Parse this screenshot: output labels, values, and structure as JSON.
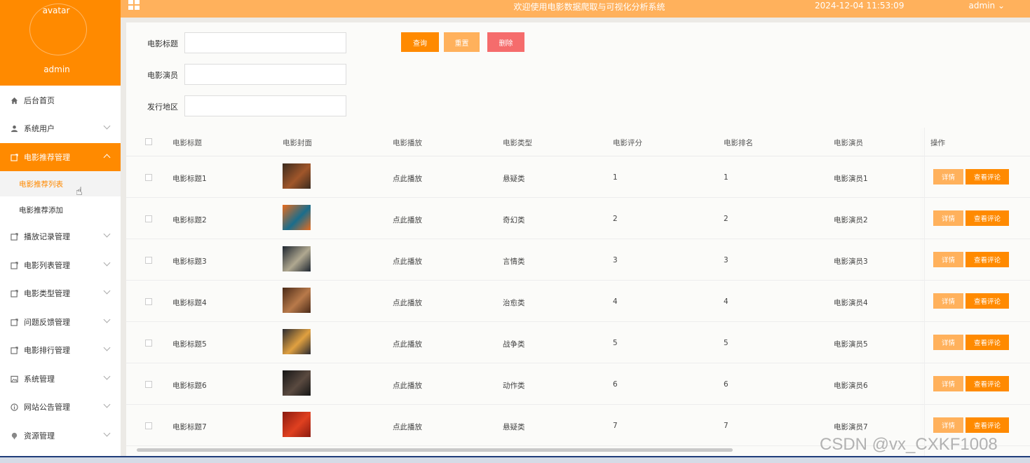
{
  "sidebar": {
    "avatar_text": "avatar",
    "username": "admin",
    "items": [
      {
        "label": "后台首页",
        "icon": "home-icon",
        "expandable": false
      },
      {
        "label": "系统用户",
        "icon": "user-icon",
        "expandable": true
      },
      {
        "label": "电影推荐管理",
        "icon": "folder-icon",
        "expandable": true,
        "active": true
      },
      {
        "label": "播放记录管理",
        "icon": "folder-icon",
        "expandable": true
      },
      {
        "label": "电影列表管理",
        "icon": "folder-icon",
        "expandable": true
      },
      {
        "label": "电影类型管理",
        "icon": "folder-icon",
        "expandable": true
      },
      {
        "label": "问题反馈管理",
        "icon": "folder-icon",
        "expandable": true
      },
      {
        "label": "电影排行管理",
        "icon": "folder-icon",
        "expandable": true
      },
      {
        "label": "系统管理",
        "icon": "image-icon",
        "expandable": true
      },
      {
        "label": "网站公告管理",
        "icon": "info-icon",
        "expandable": true
      },
      {
        "label": "资源管理",
        "icon": "pin-icon",
        "expandable": true
      }
    ],
    "subitems": [
      {
        "label": "电影推荐列表",
        "current": true
      },
      {
        "label": "电影推荐添加",
        "current": false
      }
    ]
  },
  "header": {
    "title": "欢迎使用电影数据爬取与可视化分析系统",
    "time": "2024-12-04 11:53:09",
    "user": "admin ⌄"
  },
  "search": {
    "title_label": "电影标题",
    "actor_label": "电影演员",
    "region_label": "发行地区",
    "title_value": "",
    "actor_value": "",
    "region_value": "",
    "search_button": "查询",
    "reset_button": "重置",
    "delete_button": "删除"
  },
  "table": {
    "headers": [
      "电影标题",
      "电影封面",
      "电影播放",
      "电影类型",
      "电影评分",
      "电影排名",
      "电影演员",
      "操作"
    ],
    "detail_label": "详情",
    "review_label": "查看评论",
    "rows": [
      {
        "title": "电影标题1",
        "play": "点此播放",
        "type": "悬疑类",
        "score": "1",
        "rank": "1",
        "actor": "电影演员1",
        "cover_colors": [
          "#3a2a1e",
          "#a0562a"
        ]
      },
      {
        "title": "电影标题2",
        "play": "点此播放",
        "type": "奇幻类",
        "score": "2",
        "rank": "2",
        "actor": "电影演员2",
        "cover_colors": [
          "#e86b1c",
          "#1a6d8c"
        ]
      },
      {
        "title": "电影标题3",
        "play": "点此播放",
        "type": "言情类",
        "score": "3",
        "rank": "3",
        "actor": "电影演员3",
        "cover_colors": [
          "#1e2630",
          "#b0a890"
        ]
      },
      {
        "title": "电影标题4",
        "play": "点此播放",
        "type": "治愈类",
        "score": "4",
        "rank": "4",
        "actor": "电影演员4",
        "cover_colors": [
          "#4a2a18",
          "#b87a4a"
        ]
      },
      {
        "title": "电影标题5",
        "play": "点此播放",
        "type": "战争类",
        "score": "5",
        "rank": "5",
        "actor": "电影演员5",
        "cover_colors": [
          "#2a2a30",
          "#e0a040"
        ]
      },
      {
        "title": "电影标题6",
        "play": "点此播放",
        "type": "动作类",
        "score": "6",
        "rank": "6",
        "actor": "电影演员6",
        "cover_colors": [
          "#151515",
          "#5a4a40"
        ]
      },
      {
        "title": "电影标题7",
        "play": "点此播放",
        "type": "悬疑类",
        "score": "7",
        "rank": "7",
        "actor": "电影演员7",
        "cover_colors": [
          "#8a1a10",
          "#e04020"
        ]
      }
    ]
  },
  "watermark": "CSDN @vx_CXKF1008"
}
